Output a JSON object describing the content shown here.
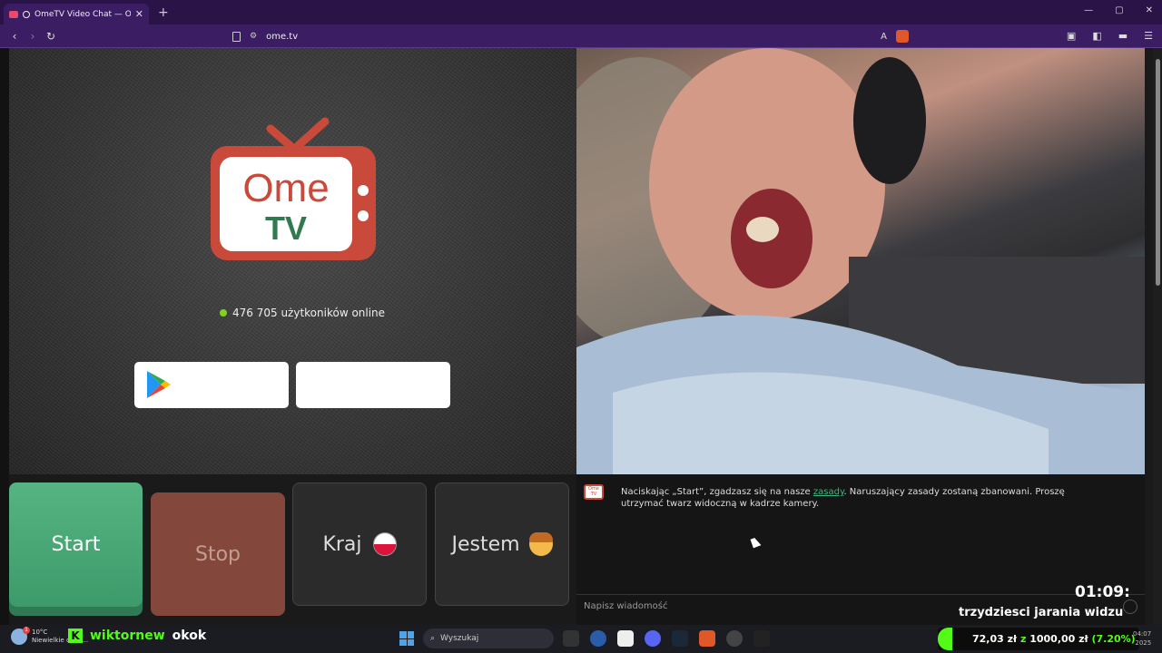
{
  "browser": {
    "tab_title": "OmeTV Video Chat — Omeg",
    "tab_close": "✕",
    "new_tab": "+",
    "url": "ome.tv",
    "window_controls": [
      "—",
      "▢",
      "✕"
    ]
  },
  "page": {
    "logo_line1": "Ome",
    "logo_line2": "TV",
    "online_count_text": "476 705 użytkoników online",
    "buttons": {
      "start": "Start",
      "stop": "Stop",
      "country": "Kraj",
      "gender": "Jestem"
    },
    "chat": {
      "message_prefix": "Naciskając „Start”, zgadzasz się na nasze ",
      "rules_link": "zasady",
      "message_suffix": ". Naruszający zasady zostaną zbanowani. Proszę utrzymać twarz widoczną w kadrze kamery.",
      "input_placeholder": "Napisz wiadomość"
    },
    "colors": {
      "start": "#4aaa78",
      "stop": "#84473b",
      "online_dot": "#7ed321",
      "logo_red": "#c94a3a",
      "logo_green": "#2f7a4f"
    }
  },
  "overlay": {
    "timer": "01:09:",
    "caption": "trzydziesci jarania widzu"
  },
  "taskbar": {
    "weather_temp": "10°C",
    "weather_desc": "Niewielkie opad...",
    "kick_name": "wiktornew",
    "kick_extra": "okok",
    "search_label": "Wyszukaj",
    "tray_text_a": "72,03 zł",
    "tray_text_z": "z",
    "tray_text_b": "1000,00 zł",
    "tray_text_pct": "(7.20%)",
    "clock_time": "04:07",
    "clock_date": "2025"
  }
}
